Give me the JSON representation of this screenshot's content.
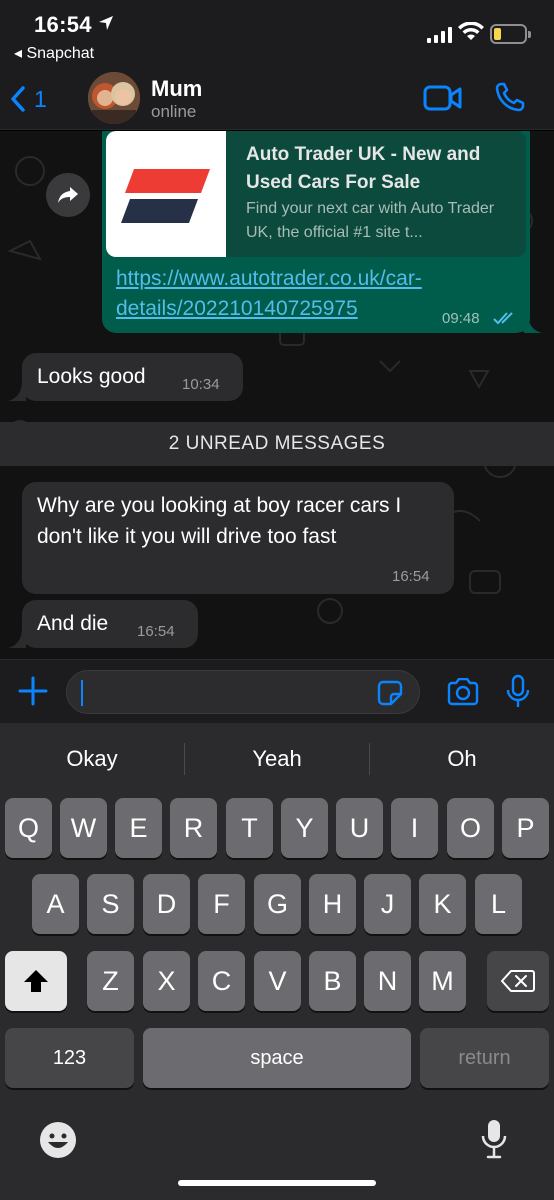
{
  "status_bar": {
    "time": "16:54",
    "back_app": "◂ Snapchat",
    "battery_color": "#f6d64a"
  },
  "header": {
    "back_count": "1",
    "contact_name": "Mum",
    "contact_status": "online"
  },
  "messages": {
    "link_preview": {
      "title": "Auto Trader UK - New and Used Cars For Sale",
      "description": "Find your next car with Auto Trader UK, the official #1 site t...",
      "url": "https://www.autotrader.co.uk/car-details/202210140725975",
      "time": "09:48"
    },
    "m1": {
      "text": "Looks good",
      "time": "10:34"
    },
    "unread_banner": "2 UNREAD MESSAGES",
    "m2": {
      "text": "Why are you looking at boy racer cars I don't like it you will drive too fast",
      "time": "16:54"
    },
    "m3": {
      "text": "And die",
      "time": "16:54"
    }
  },
  "keyboard": {
    "suggestions": [
      "Okay",
      "Yeah",
      "Oh"
    ],
    "row1": [
      "Q",
      "W",
      "E",
      "R",
      "T",
      "Y",
      "U",
      "I",
      "O",
      "P"
    ],
    "row2": [
      "A",
      "S",
      "D",
      "F",
      "G",
      "H",
      "J",
      "K",
      "L"
    ],
    "row3": [
      "Z",
      "X",
      "C",
      "V",
      "B",
      "N",
      "M"
    ],
    "numbers_label": "123",
    "space_label": "space",
    "return_label": "return"
  },
  "colors": {
    "accent": "#0a84ff",
    "outgoing_bubble": "#005c4b",
    "incoming_bubble": "#2c2c2e",
    "link": "#53bdeb"
  }
}
